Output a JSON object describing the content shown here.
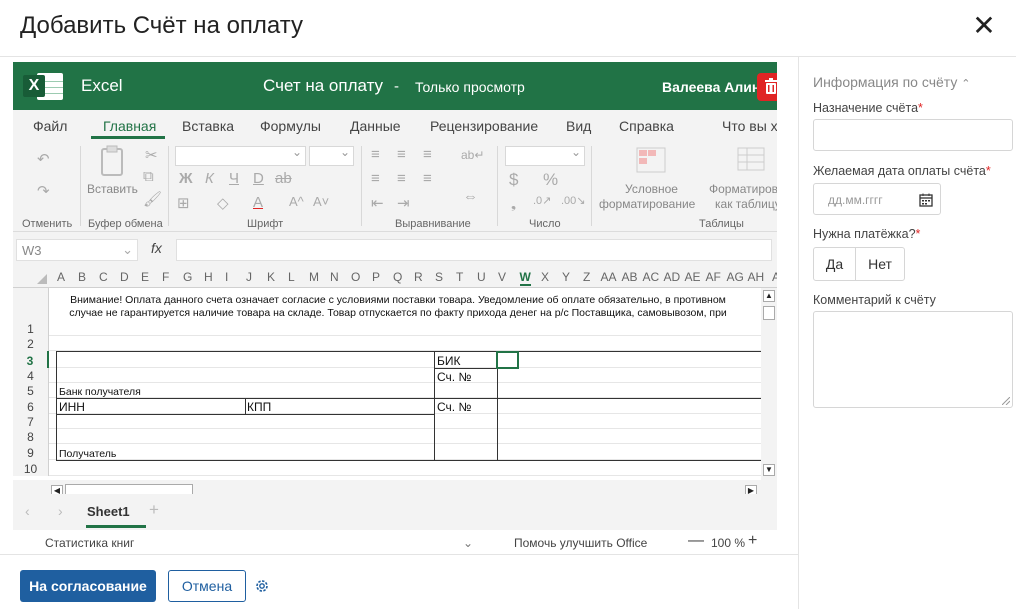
{
  "dialog": {
    "title": "Добавить Счёт на оплату",
    "close_icon": "close-icon"
  },
  "excel": {
    "app_name": "Excel",
    "doc_title": "Счет на оплату",
    "separator": "-",
    "mode": "Только просмотр",
    "user": "Валеева Алина",
    "menu": [
      "Файл",
      "Главная",
      "Вставка",
      "Формулы",
      "Данные",
      "Рецензирование",
      "Вид",
      "Справка",
      "Что вы х"
    ],
    "ribbon": {
      "undo": "Отменить",
      "clipboard_group": "Буфер обмена",
      "paste": "Вставить",
      "font_group": "Шрифт",
      "align_group": "Выравнивание",
      "number_group": "Число",
      "tables_group": "Таблицы",
      "conditional": "Условное",
      "conditional2": "форматирование",
      "format_as": "Форматиров",
      "format_as2": "как таблицу",
      "font_bold": "Ж",
      "font_italic": "К",
      "font_underline": "Ч",
      "font_double": "D",
      "font_strike": "ab",
      "font_color": "A",
      "font_grow": "A^",
      "font_shrink": "A˅",
      "currency": "$",
      "percent": "%"
    },
    "namebox": "W3",
    "fx": "fx",
    "columns": [
      "A",
      "B",
      "C",
      "D",
      "E",
      "F",
      "G",
      "H",
      "I",
      "J",
      "K",
      "L",
      "M",
      "N",
      "O",
      "P",
      "Q",
      "R",
      "S",
      "T",
      "U",
      "V",
      "W",
      "X",
      "Y",
      "Z",
      "AA",
      "AB",
      "AC",
      "AD",
      "AE",
      "AF",
      "AG",
      "AH",
      "A"
    ],
    "rows": [
      "1",
      "2",
      "3",
      "4",
      "5",
      "6",
      "7",
      "8",
      "9",
      "10"
    ],
    "warning": "Внимание! Оплата данного счета означает согласие с условиями поставки товара. Уведомление об оплате обязательно, в противном случае не гарантируется наличие товара на складе. Товар отпускается по факту прихода денег на р/с Поставщика, самовывозом, при",
    "cells": {
      "bik": "БИК",
      "acc1": "Сч. №",
      "bank": "Банк получателя",
      "inn": "ИНН",
      "kpp": "КПП",
      "acc2": "Сч. №",
      "recipient": "Получатель"
    },
    "sheet_tab": "Sheet1",
    "add_sheet": "+",
    "status_left": "Статистика книг",
    "status_help": "Помочь улучшить Office",
    "zoom": "100 %"
  },
  "sidebar": {
    "title": "Информация по счёту",
    "purpose_label": "Назначение счёта",
    "date_label": "Желаемая дата оплаты счёта",
    "date_placeholder": "дд.мм.гггг",
    "payment_label": "Нужна платёжка?",
    "yes": "Да",
    "no": "Нет",
    "comment_label": "Комментарий к счёту",
    "required_mark": "*"
  },
  "footer": {
    "approve": "На согласование",
    "cancel": "Отмена",
    "settings_icon": "gear-icon"
  },
  "colors": {
    "excel_green": "#217346",
    "primary": "#1f5fa0",
    "danger": "#e02424"
  }
}
